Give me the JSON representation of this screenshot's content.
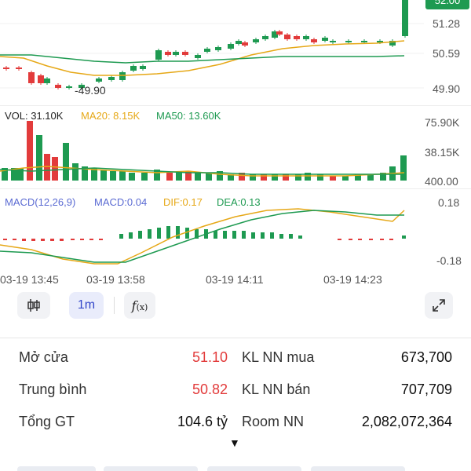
{
  "colors": {
    "up": "#1e9a51",
    "down": "#e23b3b",
    "ma20": "#e6a817",
    "ma50": "#1e9a51",
    "macd_label": "#5b6bd3",
    "accent_bg": "#e9ecfb",
    "accent_text": "#3347c9"
  },
  "price_axis": {
    "top_badge": "52.00",
    "p1": "51.28",
    "p2": "50.59",
    "p3": "49.90"
  },
  "price_annotation": "49.90",
  "volume": {
    "vol_label": "VOL: 31.10K",
    "ma20_label": "MA20: 8.15K",
    "ma50_label": "MA50: 13.60K",
    "axis_top": "75.90K",
    "axis_mid": "38.15K",
    "axis_bottom": "400.00"
  },
  "macd": {
    "label": "MACD(12,26,9)",
    "macd_val": "MACD:0.04",
    "dif_val": "DIF:0.17",
    "dea_val": "DEA:0.13",
    "axis_top": "0.18",
    "axis_bottom": "-0.18"
  },
  "time_axis": [
    "03-19 13:45",
    "03-19 13:58",
    "03-19 14:11",
    "03-19 14:23"
  ],
  "toolbar": {
    "chart_type_icon": "candlestick-icon",
    "interval": "1m",
    "indicator_icon": "function-icon",
    "expand_icon": "expand-icon"
  },
  "stats": {
    "open_label": "Mở cửa",
    "open_value": "51.10",
    "avg_label": "Trung bình",
    "avg_value": "50.82",
    "total_label": "Tổng GT",
    "total_value": "104.6 tỷ",
    "foreign_buy_label": "KL NN mua",
    "foreign_buy_value": "673,700",
    "foreign_sell_label": "KL NN bán",
    "foreign_sell_value": "707,709",
    "room_label": "Room NN",
    "room_value": "2,082,072,364"
  },
  "expand_arrow": "▼"
}
